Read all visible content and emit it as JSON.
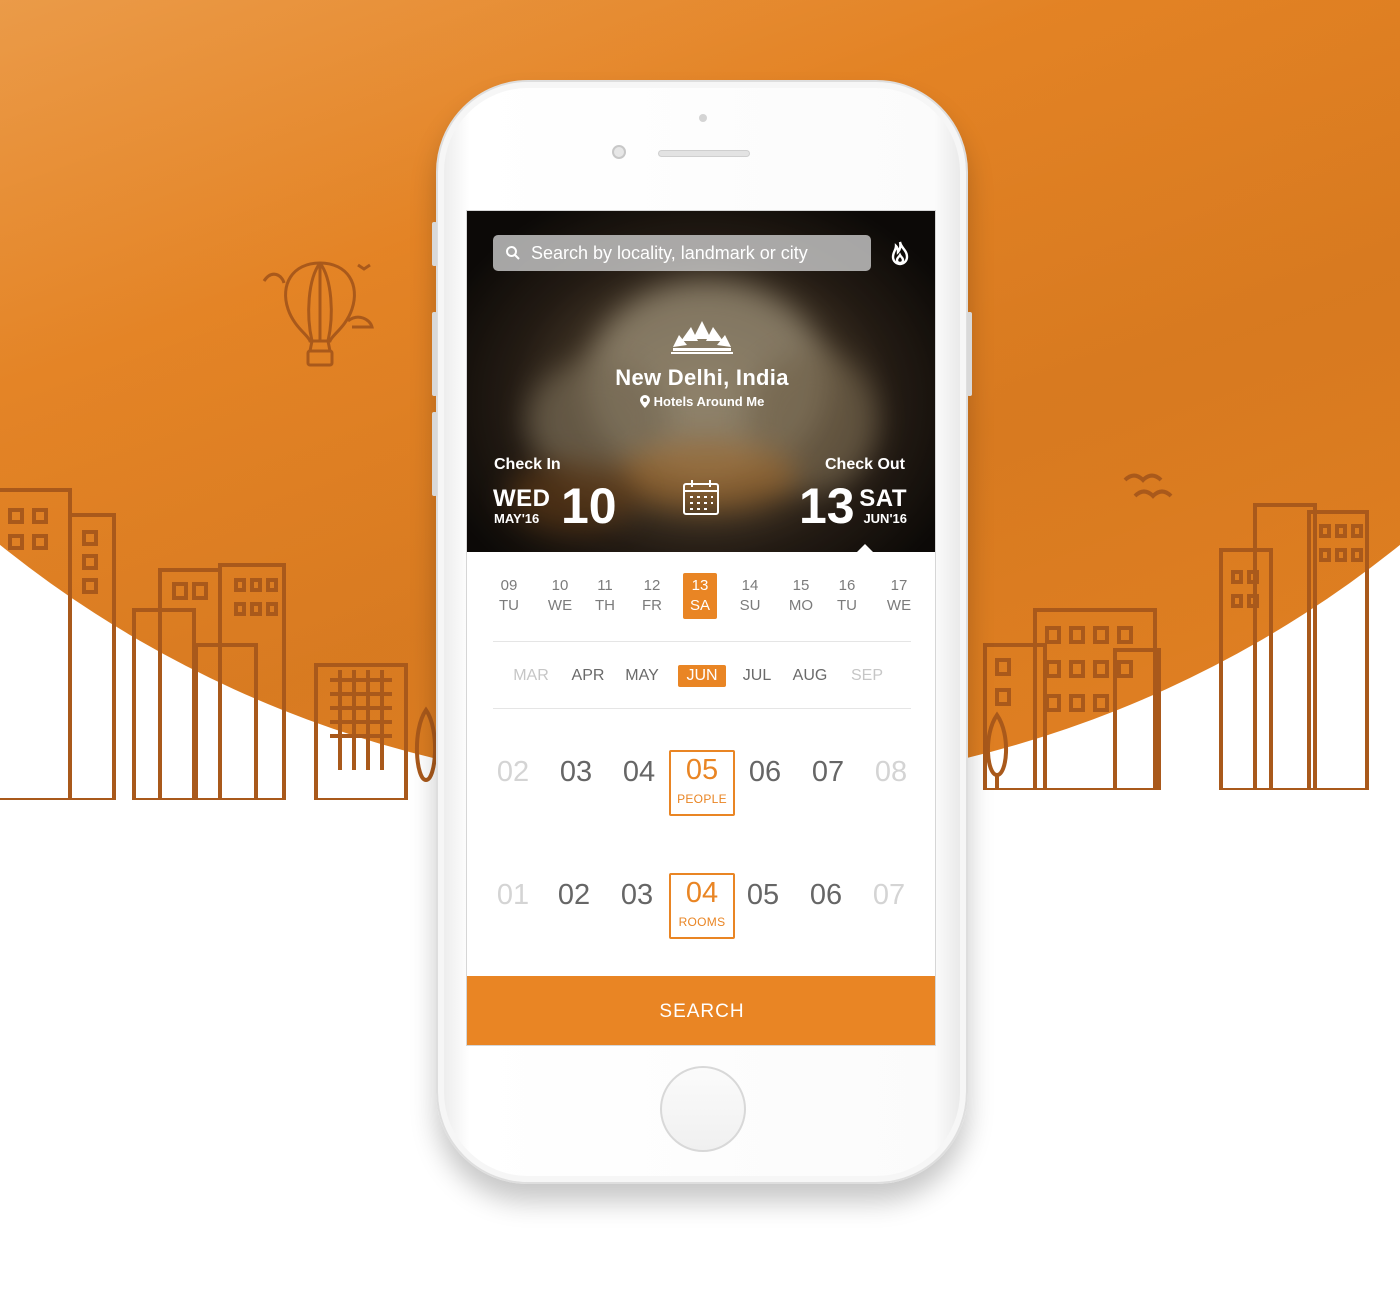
{
  "search": {
    "placeholder": "Search by locality, landmark or city"
  },
  "location": {
    "city": "New Delhi, India",
    "nearby": "Hotels Around Me"
  },
  "check_in": {
    "label": "Check In",
    "weekday": "WED",
    "month_year": "MAY'16",
    "day": "10"
  },
  "check_out": {
    "label": "Check Out",
    "weekday": "SAT",
    "month_year": "JUN'16",
    "day": "13"
  },
  "days": [
    {
      "num": "09",
      "wd": "TU"
    },
    {
      "num": "10",
      "wd": "WE"
    },
    {
      "num": "11",
      "wd": "TH"
    },
    {
      "num": "12",
      "wd": "FR"
    },
    {
      "num": "13",
      "wd": "SA"
    },
    {
      "num": "14",
      "wd": "SU"
    },
    {
      "num": "15",
      "wd": "MO"
    },
    {
      "num": "16",
      "wd": "TU"
    },
    {
      "num": "17",
      "wd": "WE"
    }
  ],
  "months": [
    "MAR",
    "APR",
    "MAY",
    "JUN",
    "JUL",
    "AUG",
    "SEP"
  ],
  "people": {
    "values": [
      "02",
      "03",
      "04",
      "05",
      "06",
      "07",
      "08"
    ],
    "selected": "05",
    "label": "PEOPLE"
  },
  "rooms": {
    "values": [
      "01",
      "02",
      "03",
      "04",
      "05",
      "06",
      "07"
    ],
    "selected": "04",
    "label": "ROOMS"
  },
  "search_button": "SEARCH",
  "colors": {
    "accent": "#E98524",
    "background": "#E48426"
  }
}
